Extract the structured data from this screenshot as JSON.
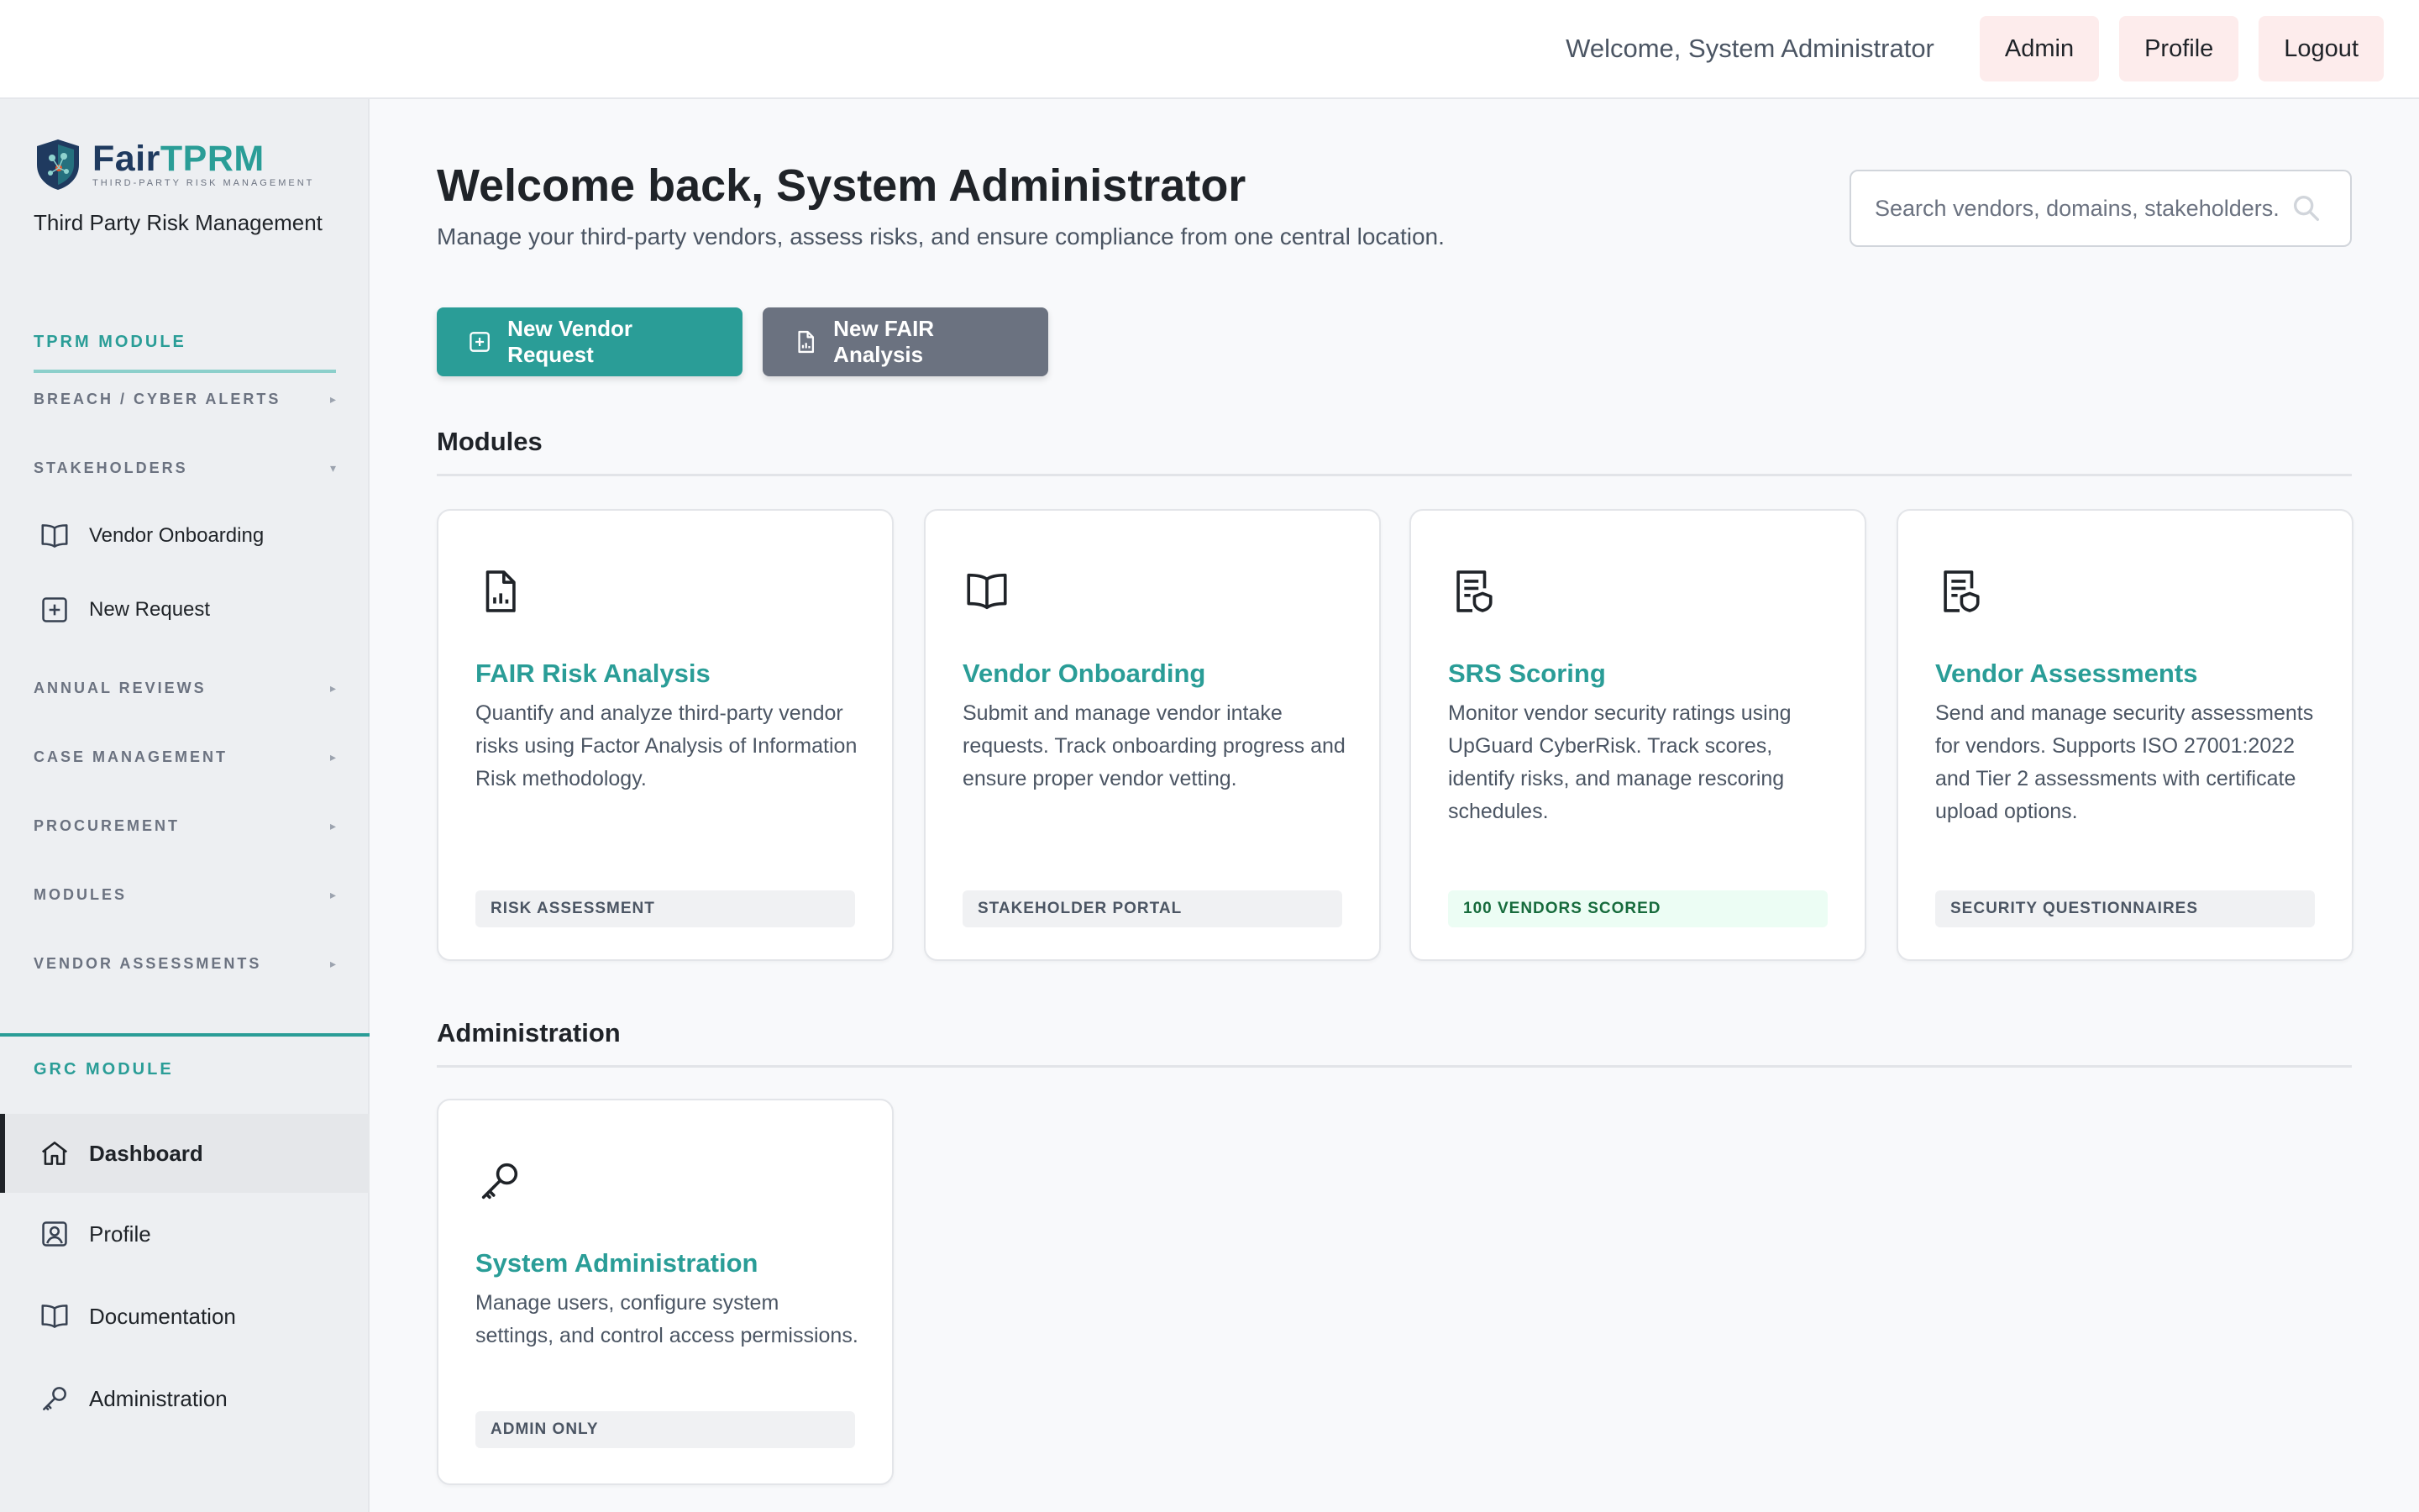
{
  "topbar": {
    "welcome": "Welcome, System Administrator",
    "buttons": {
      "admin": "Admin",
      "profile": "Profile",
      "logout": "Logout"
    }
  },
  "brand": {
    "name_part1": "Fair",
    "name_part2": "TPRM",
    "tagline": "THIRD-PARTY RISK MANAGEMENT",
    "subtitle": "Third Party Risk Management"
  },
  "sidebar": {
    "tprm_title": "TPRM MODULE",
    "groups": {
      "breach": "BREACH / CYBER ALERTS",
      "stakeholders": "STAKEHOLDERS",
      "annual": "ANNUAL REVIEWS",
      "case": "CASE MANAGEMENT",
      "procurement": "PROCUREMENT",
      "modules": "MODULES",
      "vendor_assessments": "VENDOR ASSESSMENTS"
    },
    "caret_right": "▸",
    "caret_down": "▾",
    "stakeholder_items": {
      "onboarding": "Vendor Onboarding",
      "new_request": "New Request"
    },
    "grc_title": "GRC MODULE",
    "grc_items": {
      "dashboard": "Dashboard",
      "profile": "Profile",
      "documentation": "Documentation",
      "administration": "Administration"
    }
  },
  "main": {
    "heading": "Welcome back, System Administrator",
    "lead": "Manage your third-party vendors, assess risks, and ensure compliance from one central location.",
    "search_placeholder": "Search vendors, domains, stakeholders...",
    "new_vendor_btn": "New Vendor Request",
    "new_fair_btn": "New FAIR Analysis",
    "modules_heading": "Modules",
    "admin_heading": "Administration",
    "cards": [
      {
        "title": "FAIR Risk Analysis",
        "desc": "Quantify and analyze third-party vendor risks using Factor Analysis of Information Risk methodology.",
        "tag": "RISK ASSESSMENT",
        "icon": "chart-document-icon"
      },
      {
        "title": "Vendor Onboarding",
        "desc": "Submit and manage vendor intake requests. Track onboarding progress and ensure proper vendor vetting.",
        "tag": "STAKEHOLDER PORTAL",
        "icon": "open-book-icon"
      },
      {
        "title": "SRS Scoring",
        "desc": "Monitor vendor security ratings using UpGuard CyberRisk. Track scores, identify risks, and manage rescoring schedules.",
        "tag": "100 VENDORS SCORED",
        "icon": "shield-document-icon"
      },
      {
        "title": "Vendor Assessments",
        "desc": "Send and manage security assessments for vendors. Supports ISO 27001:2022 and Tier 2 assessments with certificate upload options.",
        "tag": "SECURITY QUESTIONNAIRES",
        "icon": "shield-document-icon"
      }
    ],
    "admin_card": {
      "title": "System Administration",
      "desc": "Manage users, configure system settings, and control access permissions.",
      "tag": "ADMIN ONLY",
      "icon": "key-icon"
    }
  },
  "colors": {
    "accent": "#2a9d97",
    "brand_dark": "#1f3a5f",
    "secondary_button": "#6b7280",
    "topbar_button": "#fdecec"
  }
}
